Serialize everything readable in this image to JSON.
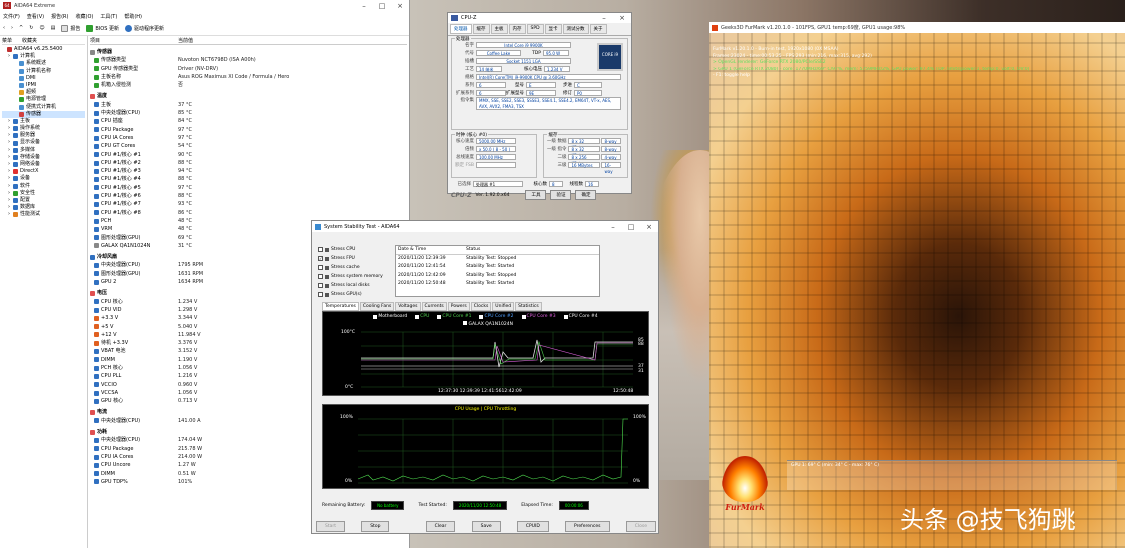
{
  "aida": {
    "title": "AIDA64 Extreme",
    "menu": [
      "文件(F)",
      "查看(V)",
      "报告(R)",
      "收藏(O)",
      "工具(T)",
      "帮助(H)"
    ],
    "toolbar": {
      "report": "报告",
      "bios": "BIOS 更新",
      "driver": "驱动程序更新"
    },
    "tree_headers": [
      "菜单",
      "收藏夹"
    ],
    "tree": [
      {
        "label": "AIDA64 v6.25.5400",
        "icon": "#c03030",
        "indent": 0
      },
      {
        "label": "计算机",
        "icon": "#3070c0",
        "indent": 1
      },
      {
        "label": "系统概述",
        "icon": "#4a90d0",
        "indent": 2
      },
      {
        "label": "计算机名称",
        "icon": "#4a90d0",
        "indent": 2
      },
      {
        "label": "DMI",
        "icon": "#4a90d0",
        "indent": 2
      },
      {
        "label": "IPMI",
        "icon": "#4a90d0",
        "indent": 2
      },
      {
        "label": "超频",
        "icon": "#e0a020",
        "indent": 2
      },
      {
        "label": "电源管理",
        "icon": "#30a030",
        "indent": 2
      },
      {
        "label": "便携式计算机",
        "icon": "#4a90d0",
        "indent": 2
      },
      {
        "label": "传感器",
        "icon": "#d04040",
        "indent": 2,
        "sel": true
      },
      {
        "label": "主板",
        "icon": "#3070c0",
        "indent": 1
      },
      {
        "label": "操作系统",
        "icon": "#3070c0",
        "indent": 1
      },
      {
        "label": "服务器",
        "icon": "#3070c0",
        "indent": 1
      },
      {
        "label": "显示设备",
        "icon": "#3070c0",
        "indent": 1
      },
      {
        "label": "多媒体",
        "icon": "#3070c0",
        "indent": 1
      },
      {
        "label": "存储设备",
        "icon": "#3070c0",
        "indent": 1
      },
      {
        "label": "网络设备",
        "icon": "#3070c0",
        "indent": 1
      },
      {
        "label": "DirectX",
        "icon": "#e03030",
        "indent": 1
      },
      {
        "label": "设备",
        "icon": "#3070c0",
        "indent": 1
      },
      {
        "label": "软件",
        "icon": "#3070c0",
        "indent": 1
      },
      {
        "label": "安全性",
        "icon": "#30a030",
        "indent": 1
      },
      {
        "label": "配置",
        "icon": "#3070c0",
        "indent": 1
      },
      {
        "label": "数据库",
        "icon": "#3070c0",
        "indent": 1
      },
      {
        "label": "性能测试",
        "icon": "#e08020",
        "indent": 1
      }
    ],
    "list_headers": [
      "项目",
      "当前值"
    ],
    "rows": [
      {
        "k": "传感器",
        "v": "",
        "sec": true,
        "icon": "#888"
      },
      {
        "k": "传感器类型",
        "v": "Nuvoton NCT6798D  (ISA A00h)",
        "icon": "#30a030"
      },
      {
        "k": "GPU 传感器类型",
        "v": "Driver  (NV-DRV)",
        "icon": "#30a030"
      },
      {
        "k": "主板名称",
        "v": "Asus ROG Maximus XI Code / Formula / Hero",
        "icon": "#30a030"
      },
      {
        "k": "机箱入侵检测",
        "v": "否",
        "icon": "#30a030"
      },
      {
        "k": "温度",
        "v": "",
        "sec": true,
        "icon": "#e05050"
      },
      {
        "k": "主板",
        "v": "37 °C",
        "icon": "#3070c0"
      },
      {
        "k": "中央处理器(CPU)",
        "v": "85 °C",
        "icon": "#3070c0"
      },
      {
        "k": "CPU 插座",
        "v": "84 °C",
        "icon": "#3070c0"
      },
      {
        "k": "CPU Package",
        "v": "97 °C",
        "icon": "#3070c0"
      },
      {
        "k": "CPU IA Cores",
        "v": "97 °C",
        "icon": "#3070c0"
      },
      {
        "k": "CPU GT Cores",
        "v": "54 °C",
        "icon": "#3070c0"
      },
      {
        "k": "CPU #1/核心 #1",
        "v": "90 °C",
        "icon": "#3070c0"
      },
      {
        "k": "CPU #1/核心 #2",
        "v": "88 °C",
        "icon": "#3070c0"
      },
      {
        "k": "CPU #1/核心 #3",
        "v": "94 °C",
        "icon": "#3070c0"
      },
      {
        "k": "CPU #1/核心 #4",
        "v": "88 °C",
        "icon": "#3070c0"
      },
      {
        "k": "CPU #1/核心 #5",
        "v": "97 °C",
        "icon": "#3070c0"
      },
      {
        "k": "CPU #1/核心 #6",
        "v": "88 °C",
        "icon": "#3070c0"
      },
      {
        "k": "CPU #1/核心 #7",
        "v": "93 °C",
        "icon": "#3070c0"
      },
      {
        "k": "CPU #1/核心 #8",
        "v": "86 °C",
        "icon": "#3070c0"
      },
      {
        "k": "PCH",
        "v": "48 °C",
        "icon": "#3070c0"
      },
      {
        "k": "VRM",
        "v": "48 °C",
        "icon": "#3070c0"
      },
      {
        "k": "图形处理器(GPU)",
        "v": "69 °C",
        "icon": "#3070c0"
      },
      {
        "k": "GALAX QA1N1024N",
        "v": "31 °C",
        "icon": "#888"
      },
      {
        "k": "冷却风扇",
        "v": "",
        "sec": true,
        "icon": "#3070c0"
      },
      {
        "k": "中央处理器(CPU)",
        "v": "1795 RPM",
        "icon": "#3070c0"
      },
      {
        "k": "图形处理器(GPU)",
        "v": "1631 RPM",
        "icon": "#3070c0"
      },
      {
        "k": "GPU 2",
        "v": "1634 RPM",
        "icon": "#3070c0"
      },
      {
        "k": "电压",
        "v": "",
        "sec": true,
        "icon": "#e05050"
      },
      {
        "k": "CPU 核心",
        "v": "1.234 V",
        "icon": "#3070c0"
      },
      {
        "k": "CPU VID",
        "v": "1.298 V",
        "icon": "#3070c0"
      },
      {
        "k": "+3.3 V",
        "v": "3.344 V",
        "icon": "#e06020"
      },
      {
        "k": "+5 V",
        "v": "5.040 V",
        "icon": "#e06020"
      },
      {
        "k": "+12 V",
        "v": "11.984 V",
        "icon": "#e06020"
      },
      {
        "k": "待机 +3.3V",
        "v": "3.376 V",
        "icon": "#e06020"
      },
      {
        "k": "VBAT 电池",
        "v": "3.152 V",
        "icon": "#3070c0"
      },
      {
        "k": "DIMM",
        "v": "1.190 V",
        "icon": "#3070c0"
      },
      {
        "k": "PCH 核心",
        "v": "1.056 V",
        "icon": "#3070c0"
      },
      {
        "k": "CPU PLL",
        "v": "1.216 V",
        "icon": "#3070c0"
      },
      {
        "k": "VCCIO",
        "v": "0.960 V",
        "icon": "#3070c0"
      },
      {
        "k": "VCCSA",
        "v": "1.056 V",
        "icon": "#3070c0"
      },
      {
        "k": "GPU 核心",
        "v": "0.713 V",
        "icon": "#3070c0"
      },
      {
        "k": "电流",
        "v": "",
        "sec": true,
        "icon": "#e05050"
      },
      {
        "k": "中央处理器(CPU)",
        "v": "141.00 A",
        "icon": "#3070c0"
      },
      {
        "k": "功耗",
        "v": "",
        "sec": true,
        "icon": "#e05050"
      },
      {
        "k": "中央处理器(CPU)",
        "v": "174.04 W",
        "icon": "#3070c0"
      },
      {
        "k": "CPU Package",
        "v": "215.78 W",
        "icon": "#3070c0"
      },
      {
        "k": "CPU IA Cores",
        "v": "214.00 W",
        "icon": "#3070c0"
      },
      {
        "k": "CPU Uncore",
        "v": "1.27 W",
        "icon": "#3070c0"
      },
      {
        "k": "DIMM",
        "v": "0.51 W",
        "icon": "#3070c0"
      },
      {
        "k": "GPU TDP%",
        "v": "101%",
        "icon": "#3070c0"
      }
    ]
  },
  "cpuz": {
    "title": "CPU-Z",
    "tabs": [
      "处理器",
      "缓存",
      "主板",
      "内存",
      "SPD",
      "显卡",
      "测试分数",
      "关于"
    ],
    "group_proc": "处理器",
    "name_l": "名字",
    "name": "Intel Core i9 9900K",
    "code_l": "代号",
    "code": "Coffee Lake",
    "tdp_l": "TDP",
    "tdp": "95.0 W",
    "pkg_l": "插槽",
    "pkg": "Socket 1151 LGA",
    "tech_l": "工艺",
    "tech": "14 纳米",
    "volt_l": "核心电压",
    "volt": "1.234 V",
    "spec_l": "规格",
    "spec": "Intel(R) Core(TM) i9-9900K CPU @ 3.60GHz",
    "fam_l": "系列",
    "fam": "6",
    "model_l": "型号",
    "model": "E",
    "step_l": "步进",
    "step": "C",
    "efam_l": "扩展系列",
    "efam": "6",
    "emod_l": "扩展型号",
    "emod": "9E",
    "rev_l": "修订",
    "rev": "P0",
    "inst_l": "指令集",
    "inst": "MMX, SSE, SSE2, SSE3, SSSE3, SSE4.1, SSE4.2, EM64T, VT-x, AES, AVX, AVX2, FMA3, TSX",
    "intel_badge": "CORE i9",
    "clock_grp": "时钟 (核心 #0)",
    "cache_grp": "缓存",
    "cs_l": "核心速度",
    "cs": "5000.00 MHz",
    "mult_l": "倍频",
    "mult": "x 50.0 ( 8 - 50 )",
    "bus_l": "总线速度",
    "bus": "100.00 MHz",
    "fsb_l": "额定 FSB",
    "l1d_l": "一级 数据",
    "l1d": "8 x 32 KBytes",
    "l1d_w": "8-way",
    "l1i_l": "一级 指令",
    "l1i": "8 x 32 KBytes",
    "l1i_w": "8-way",
    "l2_l": "二级",
    "l2": "8 x 256 KBytes",
    "l2_w": "4-way",
    "l3_l": "三级",
    "l3": "16 MBytes",
    "l3_w": "16-way",
    "sel_l": "已选择",
    "sel": "处理器 #1",
    "cores_l": "核心数",
    "cores": "8",
    "thr_l": "线程数",
    "thr": "16",
    "ver": "Ver. 1.92.0.x64",
    "tools": "工具",
    "validate": "验证",
    "ok": "确定"
  },
  "sst": {
    "title": "System Stability Test - AIDA64",
    "checks": [
      {
        "l": "Stress CPU",
        "c": false
      },
      {
        "l": "Stress FPU",
        "c": true
      },
      {
        "l": "Stress cache",
        "c": false
      },
      {
        "l": "Stress system memory",
        "c": false
      },
      {
        "l": "Stress local disks",
        "c": false
      },
      {
        "l": "Stress GPU(s)",
        "c": false
      }
    ],
    "log_headers": [
      "Date & Time",
      "Status"
    ],
    "log": [
      {
        "t": "2020/11/20 12:39:39",
        "s": "Stability Test: Stopped"
      },
      {
        "t": "2020/11/20 12:41:54",
        "s": "Stability Test: Started"
      },
      {
        "t": "2020/11/20 12:42:09",
        "s": "Stability Test: Stopped"
      },
      {
        "t": "2020/11/20 12:50:48",
        "s": "Stability Test: Started"
      }
    ],
    "tabs": [
      "Temperatures",
      "Cooling Fans",
      "Voltages",
      "Currents",
      "Powers",
      "Clocks",
      "Unified",
      "Statistics"
    ],
    "legend": [
      "Motherboard",
      "CPU",
      "CPU Core #1",
      "CPU Core #2",
      "CPU Core #3",
      "CPU Core #4"
    ],
    "legend2": "GALAX QA1N1024N",
    "g1_top": "100°C",
    "g1_bot": "0°C",
    "g1_times": "12:37:30 12:39:39 12:41:5612:42:09",
    "g1_time_end": "12:50:48",
    "g1_r1": "85",
    "g1_r2": "88",
    "g1_r3": "37",
    "g1_r4": "31",
    "g2_title": "CPU Usage  |  CPU Throttling",
    "g2_top": "100%",
    "g2_bot": "0%",
    "g2_rt": "100%",
    "g2_rb": "0%",
    "rb_l": "Remaining Battery:",
    "rb": "No battery",
    "ts_l": "Test Started:",
    "ts": "2020/11/20 12:50:48",
    "et_l": "Elapsed Time:",
    "et": "00:00:06",
    "buttons": [
      "Start",
      "Stop",
      "Clear",
      "Save",
      "CPUID",
      "Preferences",
      "Close"
    ]
  },
  "furmark": {
    "title": "Geeks3D FurMark v1.20.1.0 - 101FPS, GPU1 temp:69度, GPU1 usage:98%",
    "l1": "FurMark v1.20.1.0 - Burn-in test, 1920x1080 (0X MSAA)",
    "l2": "Frames:23024 - time:00:53:25 - FPS:293 (min:216, max:315, avg:292)",
    "l3": "> OpenGL renderer: GeForce RTX 2080/PCIe/SSE2",
    "l4": "> GPU 1 (GeForce RTX 2080) - core: 1770MHz/69° C/97%, mem: 5759MHz/2%, GPU power: 97.4% TDP, limits[power:1, temp:0, volt:0, OV:0]",
    "l5": "- F1: toggle help",
    "graph_label": "GPU 1: 69° C (min: 34° C - max: 76° C)",
    "logo_text": "FurMark"
  },
  "watermark": "头条 @技飞狗跳"
}
